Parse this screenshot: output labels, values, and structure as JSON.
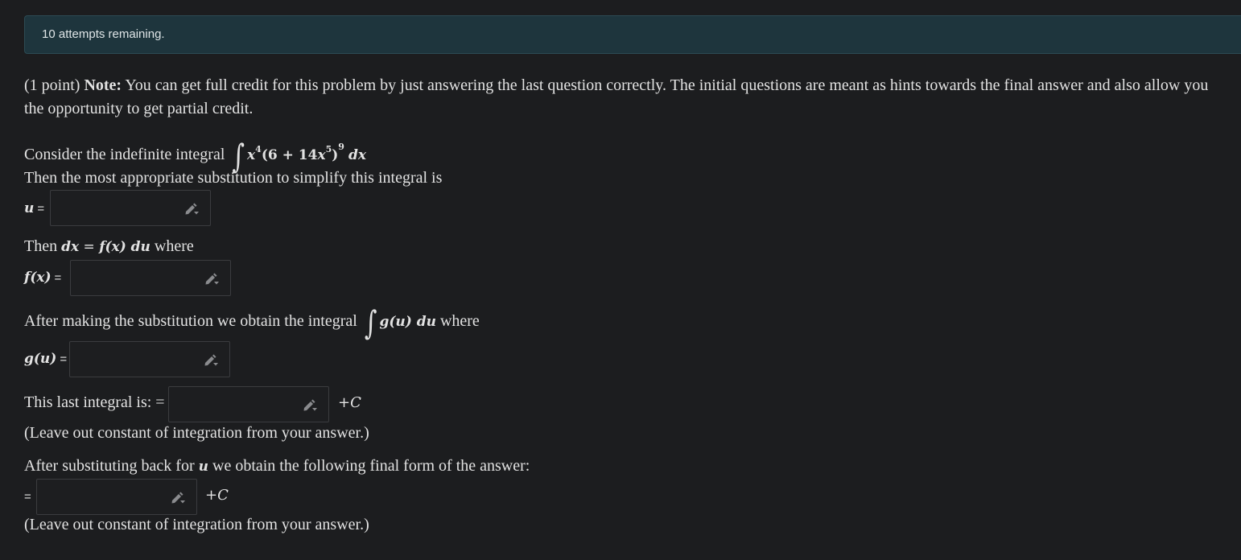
{
  "banner": {
    "attempts_text": "10 attempts remaining."
  },
  "problem": {
    "points_text": "(1 point) ",
    "note_label": "Note:",
    "note_line1": " You can get full credit for this problem by just answering the last question correctly. The initial questions are meant as hints towards the final answer and also allow you",
    "note_line2": "the opportunity to get partial credit.",
    "integral_intro": "Consider the indefinite integral",
    "integral_expr": {
      "x": "x",
      "pow4": "4",
      "inner": "(6 + 14",
      "x2": "x",
      "pow5": "5",
      "close": ")",
      "pow9": "9",
      "dx": "dx"
    },
    "substitution_text": "Then the most appropriate substitution to simplify this integral is",
    "dx_text_before": "Then ",
    "dx_math_lhs": "dx",
    "dx_math_eq": " = ",
    "dx_math_f": "f",
    "dx_math_fx": "(x)",
    "dx_math_du": " du",
    "dx_text_after": " where",
    "after_sub_text": "After making the substitution we obtain the integral",
    "after_sub_math": "g(u) du",
    "after_sub_where": " where",
    "last_integral_text": "This last integral is: =",
    "leave_out_text_1": "(Leave out constant of integration from your answer.)",
    "substitute_back_before": "After substituting back for ",
    "substitute_back_var": "u",
    "substitute_back_after": " we obtain the following final form of the answer:",
    "leave_out_text_2": "(Leave out constant of integration from your answer.)",
    "plus_c": "+C"
  },
  "fields": {
    "u_label": "u",
    "fx_label": "f(x)",
    "gu_label": "g(u)",
    "equals": "="
  },
  "icons": {
    "editor": "pencil-dropdown-icon"
  }
}
